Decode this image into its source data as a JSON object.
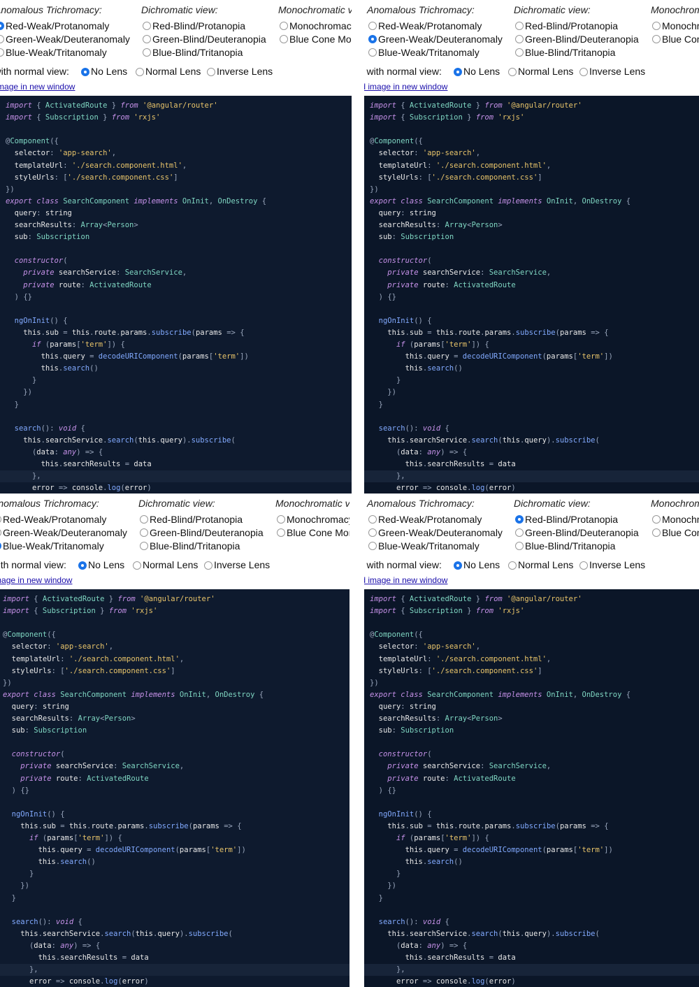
{
  "controls": {
    "anomalous_title": "Anomalous Trichromacy:",
    "dichromatic_title": "Dichromatic view:",
    "monochromatic_title": "Monochromatic view:",
    "anomalous_options": [
      "Red-Weak/Protanomaly",
      "Green-Weak/Deuteranomaly",
      "Blue-Weak/Tritanomaly"
    ],
    "dichromatic_options": [
      "Red-Blind/Protanopia",
      "Green-Blind/Deuteranopia",
      "Blue-Blind/Tritanopia"
    ],
    "monochromatic_options": [
      "Monochromacy/Achromatopsia",
      "Blue Cone Monochromacy"
    ],
    "compare_label": "Compare with normal view:",
    "lens_options": [
      "No Lens",
      "Normal Lens",
      "Inverse Lens"
    ],
    "open_link": "Open simulated image in new window"
  },
  "panels": [
    {
      "name": "top-left",
      "selected": "anomalous.0",
      "lens": "No Lens"
    },
    {
      "name": "top-right",
      "selected": "anomalous.1",
      "lens": "No Lens"
    },
    {
      "name": "bottom-left",
      "selected": "anomalous.2",
      "lens": "No Lens"
    },
    {
      "name": "bottom-right",
      "selected": "dichromatic.0",
      "lens": "No Lens"
    }
  ],
  "code_lines": [
    "import { ActivatedRoute } from '@angular/router'",
    "import { Subscription } from 'rxjs'",
    "",
    "@Component({",
    "  selector: 'app-search',",
    "  templateUrl: './search.component.html',",
    "  styleUrls: ['./search.component.css']",
    "})",
    "export class SearchComponent implements OnInit, OnDestroy {",
    "  query: string",
    "  searchResults: Array<Person>",
    "  sub: Subscription",
    "",
    "  constructor(",
    "    private searchService: SearchService,",
    "    private route: ActivatedRoute",
    "  ) {}",
    "",
    "  ngOnInit() {",
    "    this.sub = this.route.params.subscribe(params => {",
    "      if (params['term']) {",
    "        this.query = decodeURIComponent(params['term'])",
    "        this.search()",
    "      }",
    "    })",
    "  }",
    "",
    "  search(): void {",
    "    this.searchService.search(this.query).subscribe(",
    "      (data: any) => {",
    "        this.searchResults = data",
    "      },",
    "      error => console.log(error)"
  ]
}
